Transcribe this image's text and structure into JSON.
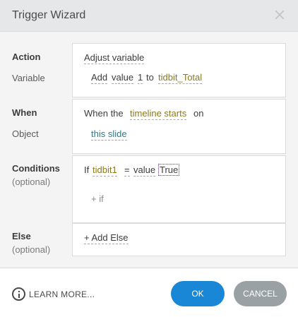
{
  "dialog": {
    "title": "Trigger Wizard",
    "close_icon": "close-icon"
  },
  "action": {
    "label": "Action",
    "value": "Adjust variable",
    "variable_label": "Variable",
    "operation": "Add",
    "value_word": "value",
    "amount": "1",
    "to_word": "to",
    "variable_name": "tidbit_Total"
  },
  "when": {
    "label": "When",
    "prefix": "When the",
    "event": "timeline starts",
    "on_word": "on",
    "object_label": "Object",
    "object": "this slide"
  },
  "conditions": {
    "label": "Conditions",
    "sublabel": "(optional)",
    "if_word": "If",
    "variable": "tidbit1",
    "operator": "=",
    "value_word": "value",
    "value": "True",
    "add_if": "+ if"
  },
  "else": {
    "label": "Else",
    "sublabel": "(optional)",
    "add_else": "+ Add Else"
  },
  "footer": {
    "info_icon": "info-icon",
    "learn_more": "LEARN MORE...",
    "ok": "OK",
    "cancel": "CANCEL"
  },
  "colors": {
    "accent_blue": "#1a86d6",
    "cancel_grey": "#9aa1a5",
    "variable_olive": "#8a7a1a",
    "object_teal": "#2d7a88"
  }
}
